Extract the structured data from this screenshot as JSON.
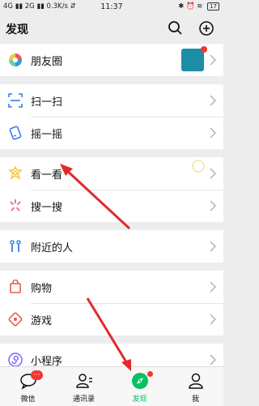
{
  "status_bar": {
    "signal_left": "4G",
    "signal_mid": "2G",
    "net_speed": "0.3K/s",
    "time": "11:37",
    "battery": "17"
  },
  "header": {
    "title": "发现"
  },
  "groups": [
    {
      "items": [
        {
          "label": "朋友圈"
        }
      ]
    },
    {
      "items": [
        {
          "label": "扫一扫"
        },
        {
          "label": "摇一摇"
        }
      ]
    },
    {
      "items": [
        {
          "label": "看一看"
        },
        {
          "label": "搜一搜"
        }
      ]
    },
    {
      "items": [
        {
          "label": "附近的人"
        }
      ]
    },
    {
      "items": [
        {
          "label": "购物"
        },
        {
          "label": "游戏"
        }
      ]
    },
    {
      "items": [
        {
          "label": "小程序"
        }
      ]
    }
  ],
  "tabs": [
    {
      "label": "微信",
      "badge": "···"
    },
    {
      "label": "通讯录"
    },
    {
      "label": "发现",
      "active": true
    },
    {
      "label": "我"
    }
  ],
  "accent_color": "#07c160"
}
